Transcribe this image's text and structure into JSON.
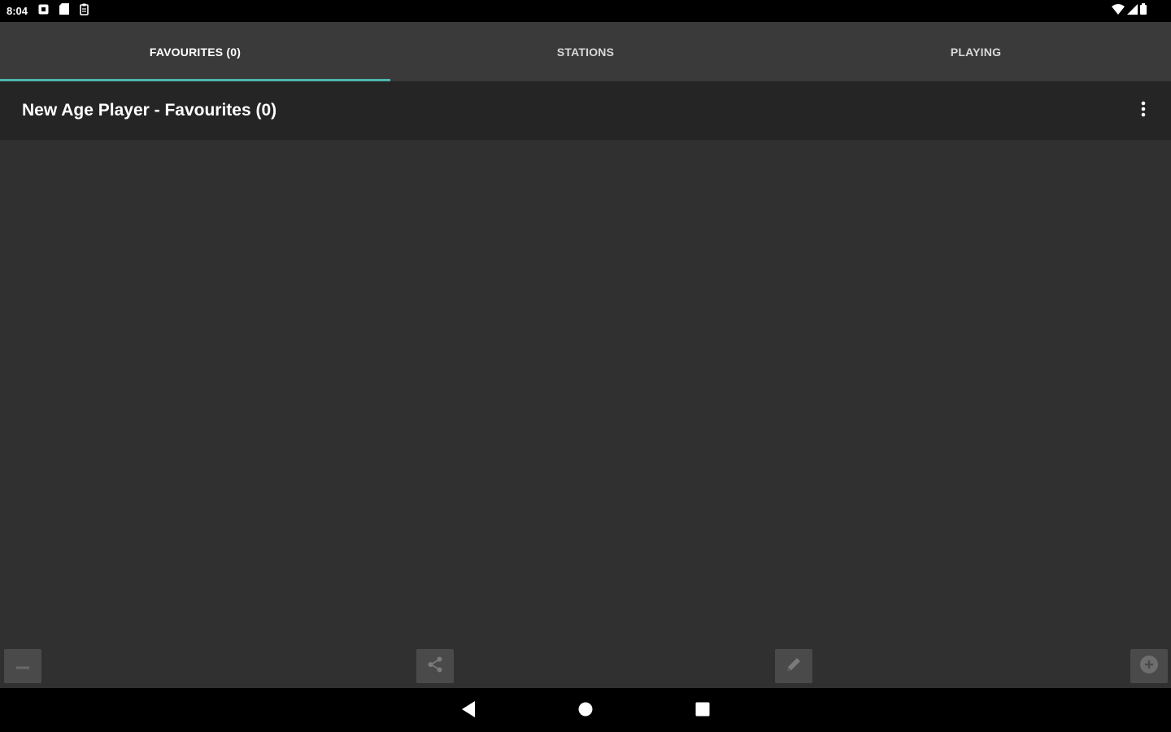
{
  "status_bar": {
    "time": "8:04"
  },
  "tabs": [
    {
      "label": "FAVOURITES (0)",
      "active": true
    },
    {
      "label": "STATIONS",
      "active": false
    },
    {
      "label": "PLAYING",
      "active": false
    }
  ],
  "toolbar": {
    "title": "New Age Player - Favourites (0)"
  },
  "colors": {
    "accent": "#4db6ac",
    "background": "#303030",
    "tab_bar": "#3a3a3a",
    "toolbar": "#252525"
  },
  "bottom_actions": {
    "icons": [
      "remove-icon",
      "share-icon",
      "edit-icon",
      "add-circle-icon"
    ]
  }
}
